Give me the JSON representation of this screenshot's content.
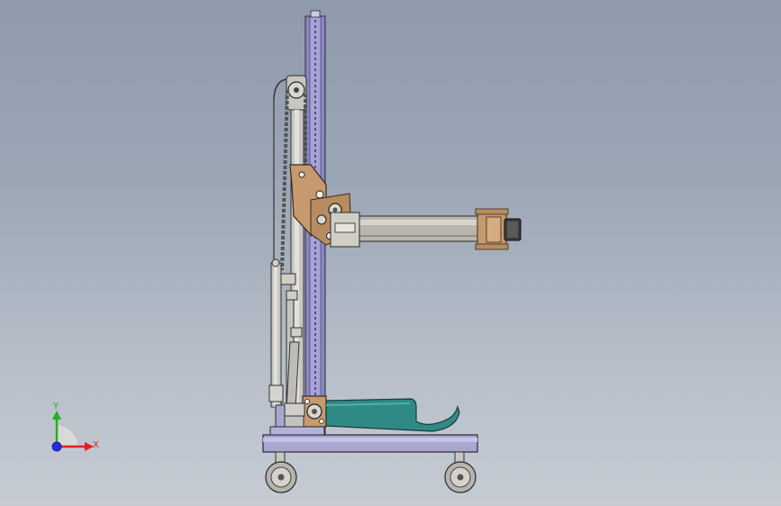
{
  "viewport": {
    "background_top": "#8f9aac",
    "background_bottom": "#c6cbd3"
  },
  "model": {
    "mast_color": "#8a86c4",
    "bracket_color": "#c69a6e",
    "arm_color": "#b9b6ae",
    "gripper_color": "#2f8a86",
    "base_color": "#a9a6d0",
    "wheel_color": "#b7b4ae"
  },
  "triad": {
    "x_label": "X",
    "y_label": "Y",
    "x_color": "#e02020",
    "y_color": "#20b020",
    "z_color": "#2030e0"
  }
}
